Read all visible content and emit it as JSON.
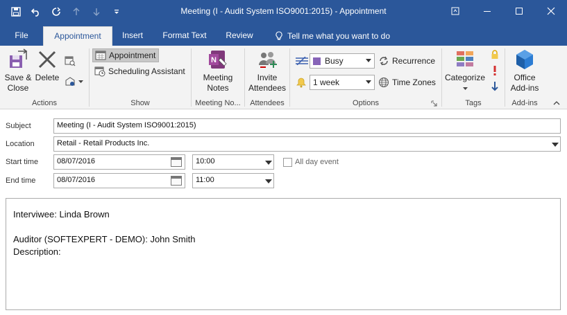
{
  "window": {
    "title": "Meeting (I - Audit System ISO9001:2015)  -  Appointment"
  },
  "tabs": [
    {
      "label": "File"
    },
    {
      "label": "Appointment"
    },
    {
      "label": "Insert"
    },
    {
      "label": "Format Text"
    },
    {
      "label": "Review"
    },
    {
      "label": "Tell me what you want to do"
    }
  ],
  "ribbon": {
    "actions": {
      "group_label": "Actions",
      "save_close": "Save &\nClose",
      "save_close_l1": "Save &",
      "save_close_l2": "Close",
      "delete": "Delete"
    },
    "show": {
      "group_label": "Show",
      "appointment": "Appointment",
      "scheduling": "Scheduling Assistant"
    },
    "meeting_notes": {
      "group_label": "Meeting No...",
      "l1": "Meeting",
      "l2": "Notes"
    },
    "attendees": {
      "group_label": "Attendees",
      "l1": "Invite",
      "l2": "Attendees"
    },
    "options": {
      "group_label": "Options",
      "show_as": "Busy",
      "reminder": "1 week",
      "recurrence": "Recurrence",
      "time_zones": "Time Zones"
    },
    "tags": {
      "group_label": "Tags",
      "categorize": "Categorize"
    },
    "addins": {
      "group_label": "Add-ins",
      "l1": "Office",
      "l2": "Add-ins"
    }
  },
  "form": {
    "subject_label": "Subject",
    "subject_value": "Meeting (I - Audit System ISO9001:2015)",
    "location_label": "Location",
    "location_value": "Retail - Retail Products Inc.",
    "start_label": "Start time",
    "start_date": "08/07/2016",
    "start_time": "10:00",
    "end_label": "End time",
    "end_date": "08/07/2016",
    "end_time": "11:00",
    "all_day_label": "All day event"
  },
  "body": {
    "line1": "Interviwee: Linda Brown",
    "line2": "",
    "line3": "Auditor (SOFTEXPERT - DEMO): John Smith",
    "line4": "Description:"
  },
  "colors": {
    "titlebar": "#2b579a",
    "busy_swatch": "#8764b8"
  }
}
